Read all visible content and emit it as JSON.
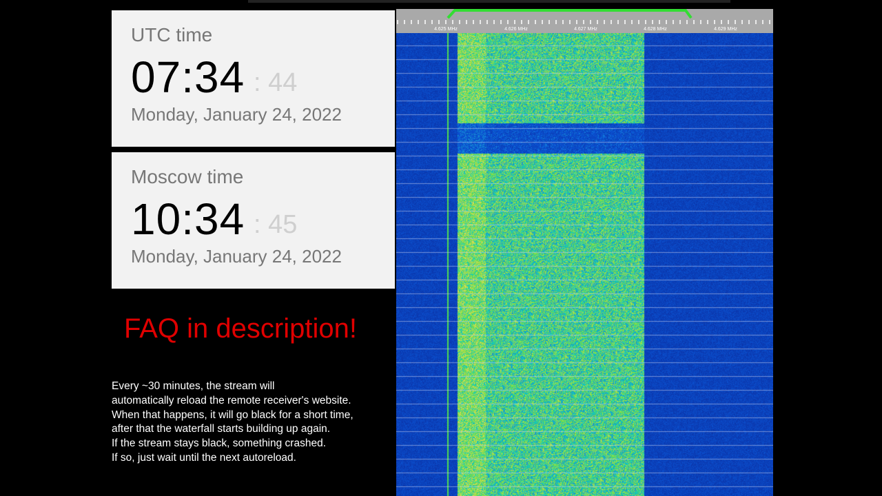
{
  "utc_clock": {
    "label": "UTC time",
    "time": "07:34",
    "seconds": ": 44",
    "date": "Monday, January 24, 2022"
  },
  "moscow_clock": {
    "label": "Moscow time",
    "time": "10:34",
    "seconds": ": 45",
    "date": "Monday, January 24, 2022"
  },
  "faq_banner": "FAQ in description!",
  "notice_lines": [
    "Every ~30 minutes, the stream will",
    "automatically reload the remote receiver's website.",
    "When that happens, it will go black for a short time,",
    "after that the waterfall starts building up again.",
    "If the stream stays black, something crashed.",
    "If so, just wait until the next autoreload."
  ],
  "waterfall": {
    "frequency_labels": [
      "4.625 MHz",
      "4.626 MHz",
      "4.627 MHz",
      "4.628 MHz",
      "4.629 MHz"
    ],
    "passband_color": "#33dd33",
    "background_color": "#0a1f8e"
  }
}
